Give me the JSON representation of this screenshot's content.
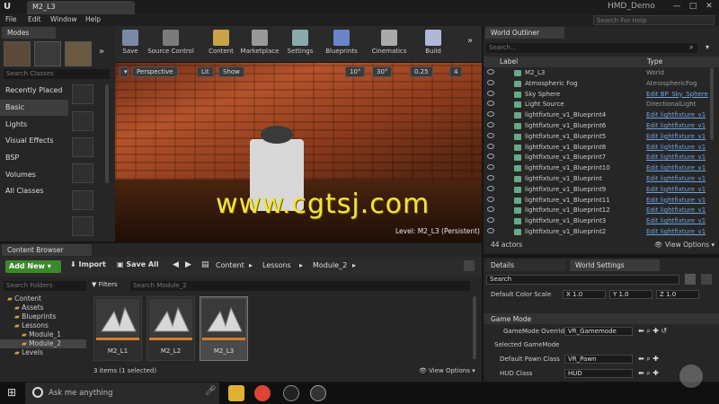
{
  "window": {
    "tab_title": "M2_L3",
    "project_name": "HMD_Demo",
    "search_help_placeholder": "Search For Help",
    "min": "—",
    "max": "□",
    "close": "✕"
  },
  "menu": [
    "File",
    "Edit",
    "Window",
    "Help"
  ],
  "modes": {
    "title": "Modes",
    "search_placeholder": "Search Classes",
    "categories": [
      "Recently Placed",
      "Basic",
      "Lights",
      "Visual Effects",
      "BSP",
      "Volumes",
      "All Classes"
    ],
    "active_category": "Basic"
  },
  "toolbar": [
    "Save",
    "Source Control",
    "Content",
    "Marketplace",
    "Settings",
    "Blueprints",
    "Cinematics",
    "Build"
  ],
  "viewport": {
    "perspective": "Perspective",
    "lit": "Lit",
    "show": "Show",
    "angle": "10°",
    "angle2": "30°",
    "scale": "0.25",
    "cam": "4",
    "level_label": "Level:  M2_L3 (Persistent)"
  },
  "watermark": "www.cgtsj.com",
  "outliner": {
    "title": "World Outliner",
    "search_placeholder": "Search...",
    "col_label": "Label",
    "col_type": "Type",
    "rows": [
      {
        "name": "M2_L3",
        "type": "World",
        "link": false
      },
      {
        "name": "Atmospheric Fog",
        "type": "AtmosphericFog",
        "link": false
      },
      {
        "name": "Sky Sphere",
        "type": "Edit BP_Sky_Sphere",
        "link": true
      },
      {
        "name": "Light Source",
        "type": "DirectionalLight",
        "link": false
      },
      {
        "name": "lightfixture_v1_Blueprint4",
        "type": "Edit lightfixture_v1",
        "link": true
      },
      {
        "name": "lightfixture_v1_Blueprint6",
        "type": "Edit lightfixture_v1",
        "link": true
      },
      {
        "name": "lightfixture_v1_Blueprint5",
        "type": "Edit lightfixture_v1",
        "link": true
      },
      {
        "name": "lightfixture_v1_Blueprint8",
        "type": "Edit lightfixture_v1",
        "link": true
      },
      {
        "name": "lightfixture_v1_Blueprint7",
        "type": "Edit lightfixture_v1",
        "link": true
      },
      {
        "name": "lightfixture_v1_Blueprint10",
        "type": "Edit lightfixture_v1",
        "link": true
      },
      {
        "name": "lightfixture_v1_Blueprint",
        "type": "Edit lightfixture_v1",
        "link": true
      },
      {
        "name": "lightfixture_v1_Blueprint9",
        "type": "Edit lightfixture_v1",
        "link": true
      },
      {
        "name": "lightfixture_v1_Blueprint11",
        "type": "Edit lightfixture_v1",
        "link": true
      },
      {
        "name": "lightfixture_v1_Blueprint12",
        "type": "Edit lightfixture_v1",
        "link": true
      },
      {
        "name": "lightfixture_v1_Blueprint3",
        "type": "Edit lightfixture_v1",
        "link": true
      },
      {
        "name": "lightfixture_v1_Blueprint2",
        "type": "Edit lightfixture_v1",
        "link": true
      }
    ],
    "actor_count": "44 actors",
    "view_options": "View Options"
  },
  "details": {
    "tab_details": "Details",
    "tab_world": "World Settings",
    "search_placeholder": "Search",
    "color_scale_label": "Default Color Scale",
    "x": "X  1.0",
    "y": "Y  1.0",
    "z": "Z  1.0",
    "section_game_mode": "Game Mode",
    "gm_override_label": "GameMode Override",
    "gm_override_value": "VR_Gamemode",
    "section_selected": "Selected GameMode",
    "pawn_label": "Default Pawn Class",
    "pawn_value": "VR_Pawn",
    "hud_label": "HUD Class",
    "hud_value": "HUD"
  },
  "content_browser": {
    "title": "Content Browser",
    "add_new": "Add New",
    "import": "Import",
    "save_all": "Save All",
    "crumbs": [
      "Content",
      "Lessons",
      "Module_2"
    ],
    "folder_search": "Search Folders",
    "filters": "Filters",
    "search_placeholder": "Search Module_2",
    "tree": [
      {
        "name": "Content",
        "indent": 0,
        "sel": false
      },
      {
        "name": "Assets",
        "indent": 1,
        "sel": false
      },
      {
        "name": "Blueprints",
        "indent": 1,
        "sel": false
      },
      {
        "name": "Lessons",
        "indent": 1,
        "sel": false
      },
      {
        "name": "Module_1",
        "indent": 2,
        "sel": false
      },
      {
        "name": "Module_2",
        "indent": 2,
        "sel": true
      },
      {
        "name": "Levels",
        "indent": 1,
        "sel": false
      }
    ],
    "assets": [
      "M2_L1",
      "M2_L2",
      "M2_L3"
    ],
    "selected_asset": "M2_L3",
    "item_count": "3 items (1 selected)",
    "view_options": "View Options"
  },
  "taskbar": {
    "search": "Ask me anything"
  }
}
